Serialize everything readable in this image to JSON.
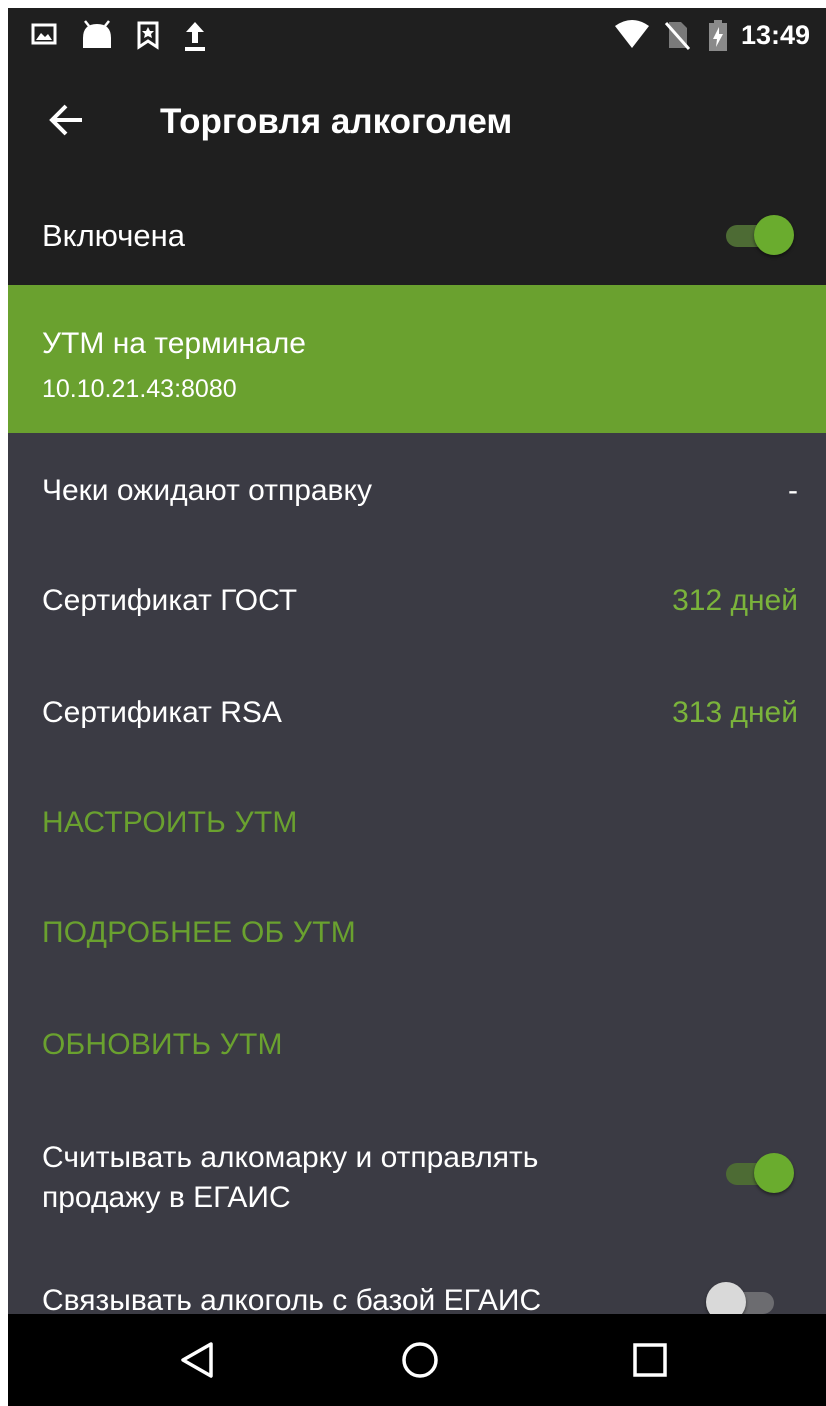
{
  "status_bar": {
    "time": "13:49",
    "icons": [
      "image-notification-icon",
      "android-icon",
      "bookmark-notification-icon",
      "upload-icon",
      "wifi-icon",
      "no-sim-icon",
      "battery-charging-icon"
    ]
  },
  "app_bar": {
    "title": "Торговля алкоголем",
    "back_icon": "arrow-back-icon"
  },
  "enabled": {
    "label": "Включена",
    "on": true
  },
  "utm": {
    "title": "УТМ на терминале",
    "address": "10.10.21.43:8080"
  },
  "info_rows": [
    {
      "label": "Чеки ожидают отправку",
      "value": "-"
    },
    {
      "label": "Сертификат ГОСТ",
      "value": "312 дней"
    },
    {
      "label": "Сертификат RSA",
      "value": "313 дней"
    }
  ],
  "actions": {
    "configure": "НАСТРОИТЬ УТМ",
    "details": "ПОДРОБНЕЕ ОБ УТМ",
    "update": "ОБНОВИТЬ УТМ"
  },
  "settings": [
    {
      "label": "Считывать алкомарку и отправлять продажу в ЕГАИС",
      "on": true
    },
    {
      "label": "Связывать алкоголь с базой ЕГАИС",
      "on": false
    }
  ],
  "nav_bar": {
    "icons": [
      "back-triangle-icon",
      "home-circle-icon",
      "recents-square-icon"
    ]
  },
  "colors": {
    "accent": "#6aa12f",
    "background": "#3b3b44",
    "bar": "#1f1f1f"
  }
}
